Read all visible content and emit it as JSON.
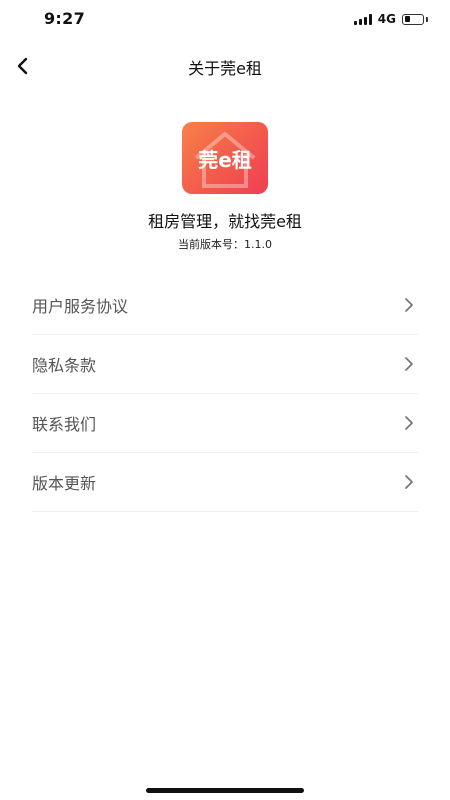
{
  "status_bar": {
    "time": "9:27",
    "network": "4G",
    "signal_bars": 4,
    "battery_level": 0.3
  },
  "nav": {
    "title": "关于莞e租",
    "back_icon": "chevron-left-icon"
  },
  "app": {
    "logo_text": "莞e租",
    "slogan": "租房管理，就找莞e租",
    "version_label": "当前版本号：1.1.0"
  },
  "menu": {
    "items": [
      {
        "label": "用户服务协议",
        "icon": "chevron-right-icon"
      },
      {
        "label": "隐私条款",
        "icon": "chevron-right-icon"
      },
      {
        "label": "联系我们",
        "icon": "chevron-right-icon"
      },
      {
        "label": "版本更新",
        "icon": "chevron-right-icon"
      }
    ]
  },
  "colors": {
    "logo_gradient_start": "#f6824a",
    "logo_gradient_end": "#ef3f55",
    "menu_text": "#555555",
    "divider": "#eeeeee"
  }
}
